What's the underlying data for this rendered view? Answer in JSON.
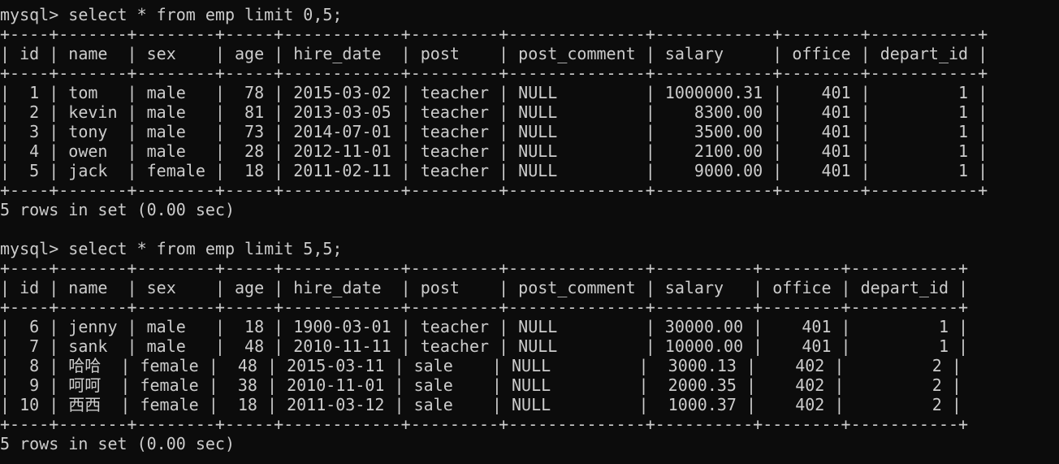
{
  "queries": [
    {
      "prompt": "mysql> select * from emp limit 0,5;",
      "columns": [
        "id",
        "name",
        "sex",
        "age",
        "hire_date",
        "post",
        "post_comment",
        "salary",
        "office",
        "depart_id"
      ],
      "rows": [
        [
          "1",
          "tom",
          "male",
          "78",
          "2015-03-02",
          "teacher",
          "NULL",
          "1000000.31",
          "401",
          "1"
        ],
        [
          "2",
          "kevin",
          "male",
          "81",
          "2013-03-05",
          "teacher",
          "NULL",
          "8300.00",
          "401",
          "1"
        ],
        [
          "3",
          "tony",
          "male",
          "73",
          "2014-07-01",
          "teacher",
          "NULL",
          "3500.00",
          "401",
          "1"
        ],
        [
          "4",
          "owen",
          "male",
          "28",
          "2012-11-01",
          "teacher",
          "NULL",
          "2100.00",
          "401",
          "1"
        ],
        [
          "5",
          "jack",
          "female",
          "18",
          "2011-02-11",
          "teacher",
          "NULL",
          "9000.00",
          "401",
          "1"
        ]
      ],
      "result": "5 rows in set (0.00 sec)"
    },
    {
      "prompt": "mysql> select * from emp limit 5,5;",
      "columns": [
        "id",
        "name",
        "sex",
        "age",
        "hire_date",
        "post",
        "post_comment",
        "salary",
        "office",
        "depart_id"
      ],
      "rows": [
        [
          "6",
          "jenny",
          "male",
          "18",
          "1900-03-01",
          "teacher",
          "NULL",
          "30000.00",
          "401",
          "1"
        ],
        [
          "7",
          "sank",
          "male",
          "48",
          "2010-11-11",
          "teacher",
          "NULL",
          "10000.00",
          "401",
          "1"
        ],
        [
          "8",
          "哈哈",
          "female",
          "48",
          "2015-03-11",
          "sale",
          "NULL",
          "3000.13",
          "402",
          "2"
        ],
        [
          "9",
          "呵呵",
          "female",
          "38",
          "2010-11-01",
          "sale",
          "NULL",
          "2000.35",
          "402",
          "2"
        ],
        [
          "10",
          "西西",
          "female",
          "18",
          "2011-03-12",
          "sale",
          "NULL",
          "1000.37",
          "402",
          "2"
        ]
      ],
      "result": "5 rows in set (0.00 sec)"
    }
  ]
}
